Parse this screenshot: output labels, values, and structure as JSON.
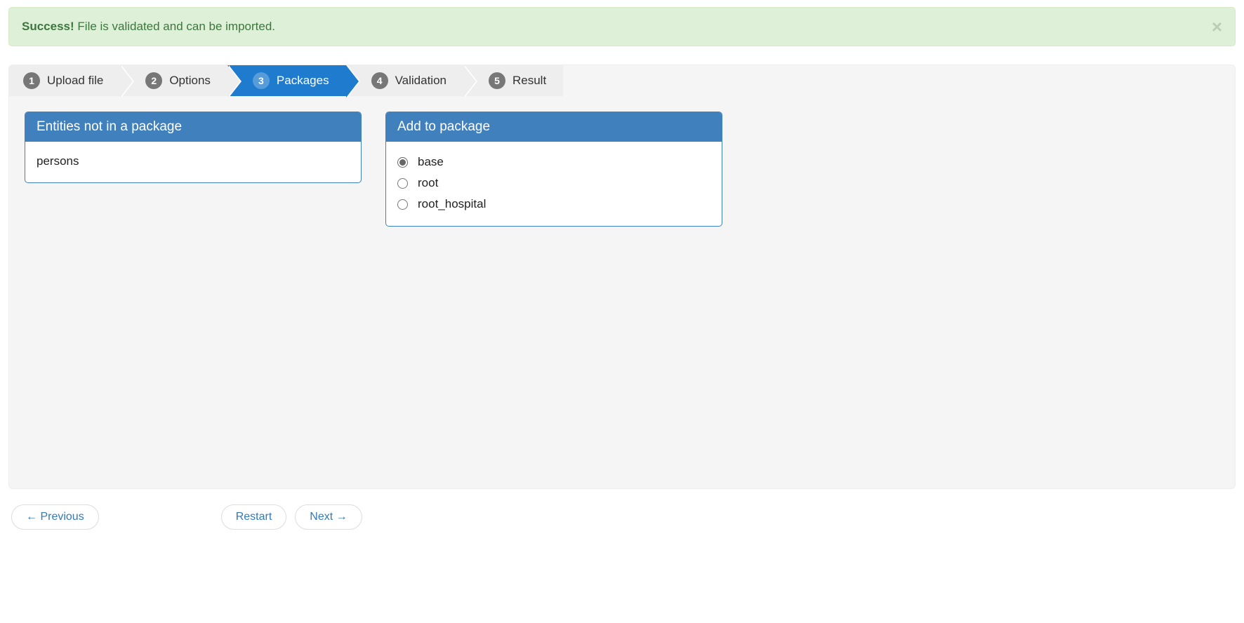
{
  "alert": {
    "strong": "Success!",
    "text": "File is validated and can be imported."
  },
  "wizard": {
    "steps": [
      {
        "num": "1",
        "label": "Upload file"
      },
      {
        "num": "2",
        "label": "Options"
      },
      {
        "num": "3",
        "label": "Packages"
      },
      {
        "num": "4",
        "label": "Validation"
      },
      {
        "num": "5",
        "label": "Result"
      }
    ],
    "active_index": 2
  },
  "panels": {
    "entities": {
      "title": "Entities not in a package",
      "items": [
        "persons"
      ]
    },
    "add": {
      "title": "Add to package",
      "options": [
        {
          "label": "base",
          "selected": true
        },
        {
          "label": "root",
          "selected": false
        },
        {
          "label": "root_hospital",
          "selected": false
        }
      ]
    }
  },
  "footer": {
    "previous": "← Previous",
    "restart": "Restart",
    "next": "Next →"
  }
}
